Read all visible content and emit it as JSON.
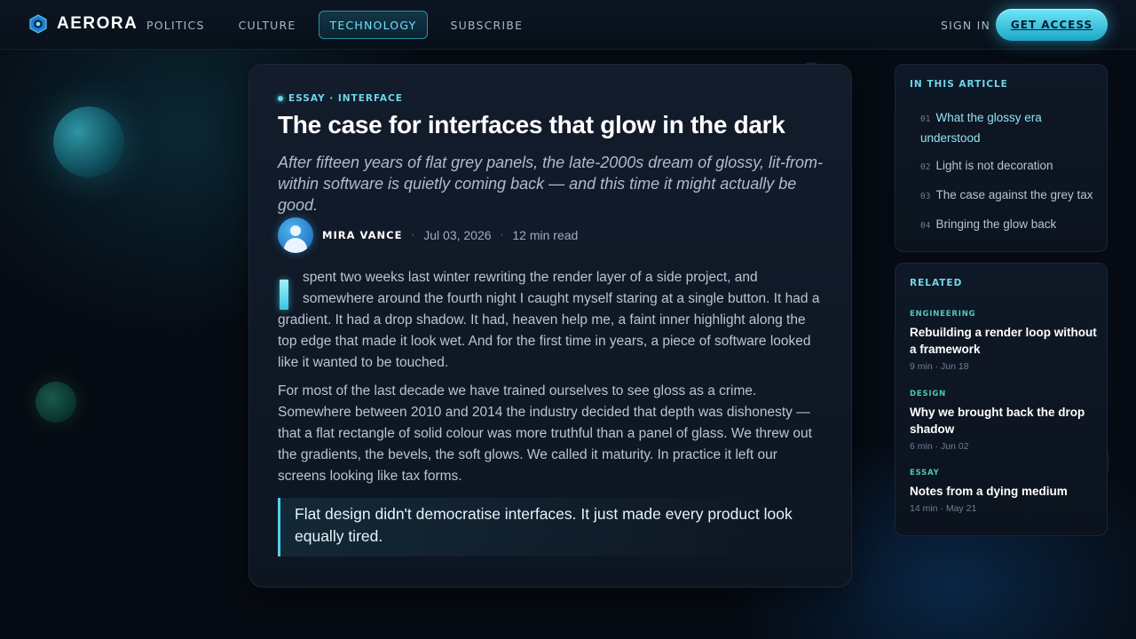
{
  "colors": {
    "accent": "#6fe0f5",
    "background": "#060b13",
    "card": "#121c2b",
    "category": "#50c6b9"
  },
  "brand": {
    "name": "AERORA",
    "icon": "hexagon-logo-icon"
  },
  "nav": {
    "links": [
      {
        "label": "POLITICS",
        "active": false
      },
      {
        "label": "CULTURE",
        "active": false
      },
      {
        "label": "TECHNOLOGY",
        "active": true
      },
      {
        "label": "SUBSCRIBE",
        "active": false
      }
    ],
    "sign_in": "SIGN IN",
    "cta": "GET ACCESS"
  },
  "article": {
    "kicker": "ESSAY · INTERFACE",
    "title": "The case for interfaces that glow in the dark",
    "dek": "After fifteen years of flat grey panels, the late-2000s dream of glossy, lit-from-within software is quietly coming back — and this time it might actually be good.",
    "author": "MIRA VANCE",
    "date": "Jul 03, 2026",
    "read_time": "12 min read",
    "separator": "·",
    "paragraphs": [
      "spent two weeks last winter rewriting the render layer of a side project, and somewhere around the fourth night I caught myself staring at a single button. It had a gradient. It had a drop shadow. It had, heaven help me, a faint inner highlight along the top edge that made it look wet. And for the first time in years, a piece of software looked like it wanted to be touched.",
      "For most of the last decade we have trained ourselves to see gloss as a crime. Somewhere between 2010 and 2014 the industry decided that depth was dishonesty — that a flat rectangle of solid colour was more truthful than a panel of glass. We threw out the gradients, the bevels, the soft glows. We called it maturity. In practice it left our screens looking like tax forms."
    ],
    "pull_quote": "Flat design didn't democratise interfaces. It just made every product look equally tired."
  },
  "toc": {
    "title": "IN THIS ARTICLE",
    "items": [
      {
        "num": "01",
        "label": "What the glossy era understood",
        "active": true
      },
      {
        "num": "02",
        "label": "Light is not decoration",
        "active": false
      },
      {
        "num": "03",
        "label": "The case against the grey tax",
        "active": false
      },
      {
        "num": "04",
        "label": "Bringing the glow back",
        "active": false
      }
    ]
  },
  "related": {
    "title": "RELATED",
    "items": [
      {
        "category": "ENGINEERING",
        "title": "Rebuilding a render loop without a framework",
        "meta": "9 min · Jun 18"
      },
      {
        "category": "DESIGN",
        "title": "Why we brought back the drop shadow",
        "meta": "6 min · Jun 02"
      },
      {
        "category": "ESSAY",
        "title": "Notes from a dying medium",
        "meta": "14 min · May 21"
      }
    ]
  }
}
